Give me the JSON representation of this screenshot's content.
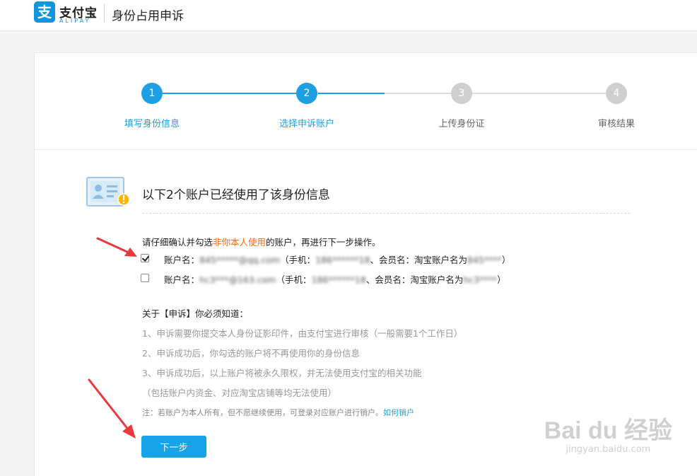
{
  "header": {
    "logo_mark": "支",
    "logo_cn": "支付宝",
    "logo_en": "ALIPAY",
    "page_title": "身份占用申诉"
  },
  "steps": [
    {
      "num": "1",
      "label": "填写身份信息",
      "state": "done"
    },
    {
      "num": "2",
      "label": "选择申诉账户",
      "state": "current"
    },
    {
      "num": "3",
      "label": "上传身份证",
      "state": "todo"
    },
    {
      "num": "4",
      "label": "审核结果",
      "state": "todo"
    }
  ],
  "notice": {
    "title": "以下2个账户已经使用了该身份信息",
    "instruction_pre": "请仔细确认并勾选",
    "instruction_warn": "非你本人使用",
    "instruction_post": "的账户，再进行下一步操作。"
  },
  "accounts": [
    {
      "checked": true,
      "name_label": "账户名：",
      "name_value": "845*****@qq.com",
      "phone_label": "（手机：",
      "phone_value": "186******18",
      "member_label": "、会员名：淘宝账户名为",
      "member_value": "845****",
      "close": "）"
    },
    {
      "checked": false,
      "name_label": "账户名：",
      "name_value": "hc3***@163.com",
      "phone_label": "（手机：",
      "phone_value": "186******18",
      "member_label": "、会员名：淘宝账户名为",
      "member_value": "hc3****",
      "close": "）"
    }
  ],
  "rules": {
    "title": "关于【申诉】你必须知道：",
    "items": [
      "1、申诉需要你提交本人身份证影印件，由支付宝进行审核（一般需要1个工作日）",
      "2、申诉成功后，你勾选的账户将不再使用你的身份信息",
      "3、申诉成功后，以上账户将被永久限权，并无法使用支付宝的相关功能",
      "（包括账户内资金、对应淘宝店铺等均无法使用）"
    ],
    "note_text": "注：若账户为本人所有，但不愿继续使用，可登录对应账户进行销户。",
    "note_link": "如何销户"
  },
  "actions": {
    "next_label": "下一步"
  },
  "watermark": {
    "main": "Bai du 经验",
    "url": "jingyan.baidu.com"
  },
  "colors": {
    "brand_blue": "#1e9fe2",
    "warn_orange": "#ff6a00",
    "step_inactive": "#cfcfcf",
    "arrow_red": "#e8393b"
  }
}
